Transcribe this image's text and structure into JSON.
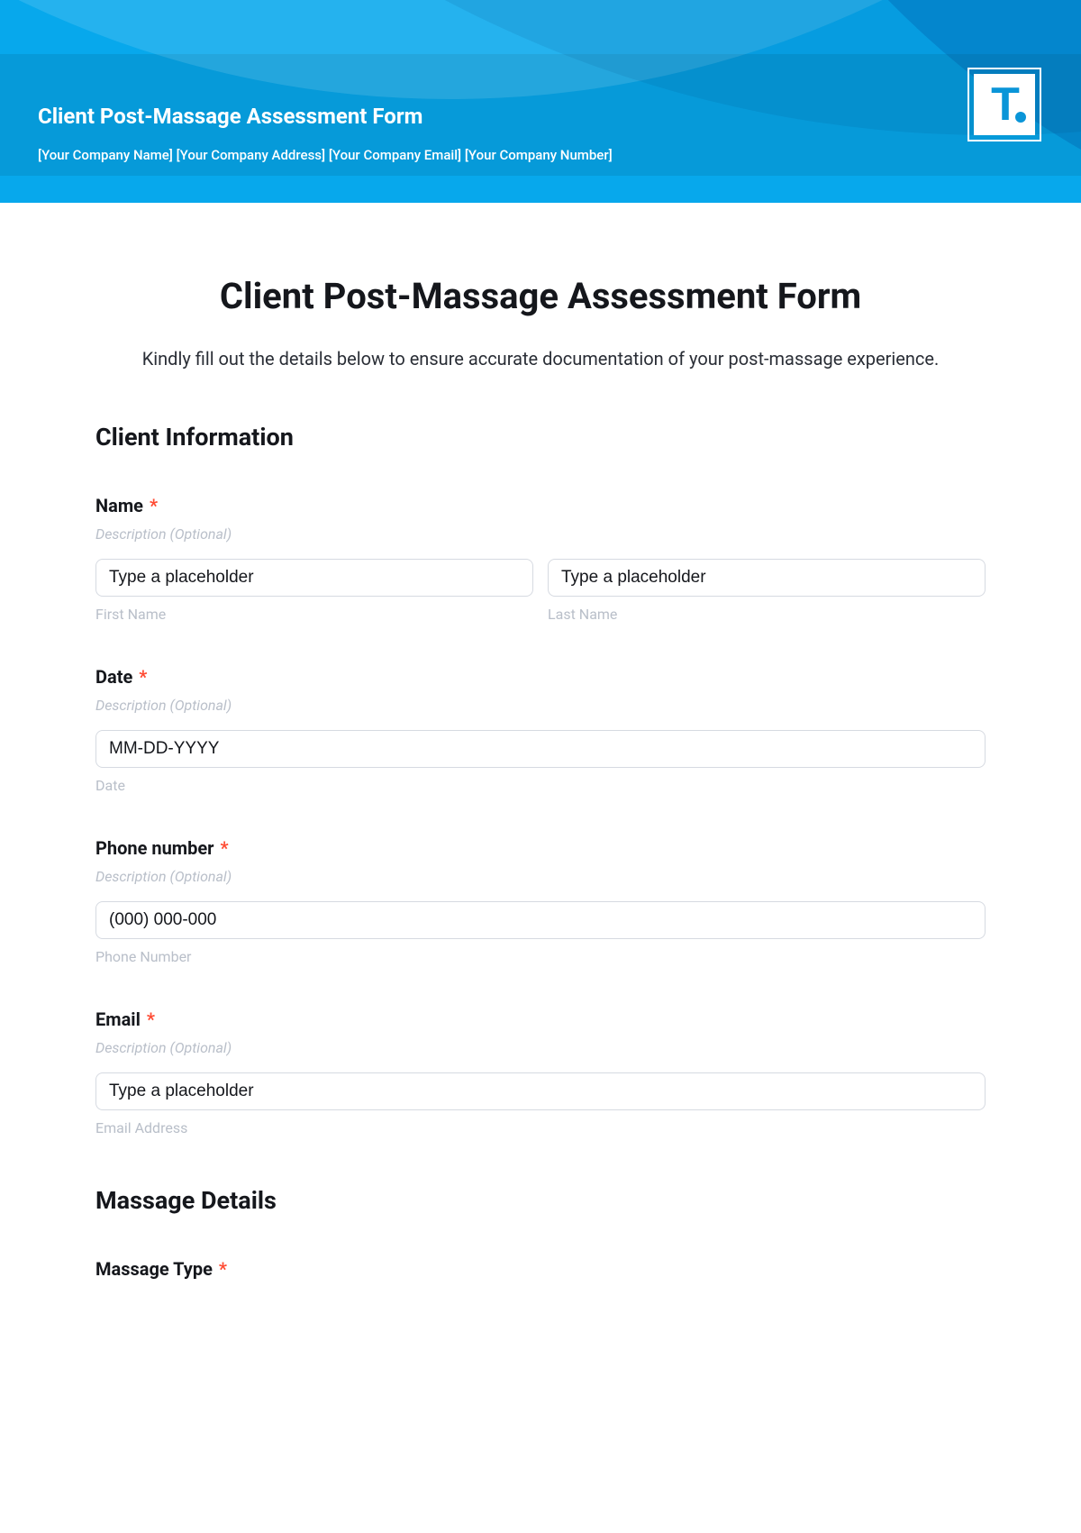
{
  "banner": {
    "title": "Client Post-Massage Assessment Form",
    "subline": "[Your Company Name] [Your Company Address] [Your Company Email] [Your Company Number]",
    "logo_letter": "T"
  },
  "page": {
    "title": "Client Post-Massage Assessment Form",
    "intro": "Kindly fill out the details below to ensure accurate documentation of your post-massage experience."
  },
  "sections": {
    "client_info_heading": "Client Information",
    "massage_details_heading": "Massage Details"
  },
  "fields": {
    "name": {
      "label": "Name",
      "required_mark": "*",
      "desc": "Description (Optional)",
      "first_placeholder": "Type a placeholder",
      "first_sub": "First Name",
      "last_placeholder": "Type a placeholder",
      "last_sub": "Last Name"
    },
    "date": {
      "label": "Date",
      "required_mark": "*",
      "desc": "Description (Optional)",
      "placeholder": "MM-DD-YYYY",
      "sub": "Date"
    },
    "phone": {
      "label": "Phone number",
      "required_mark": "*",
      "desc": "Description (Optional)",
      "placeholder": "(000) 000-000",
      "sub": "Phone Number"
    },
    "email": {
      "label": "Email",
      "required_mark": "*",
      "desc": "Description (Optional)",
      "placeholder": "Type a placeholder",
      "sub": "Email Address"
    },
    "massage_type": {
      "label": "Massage Type",
      "required_mark": "*"
    }
  }
}
